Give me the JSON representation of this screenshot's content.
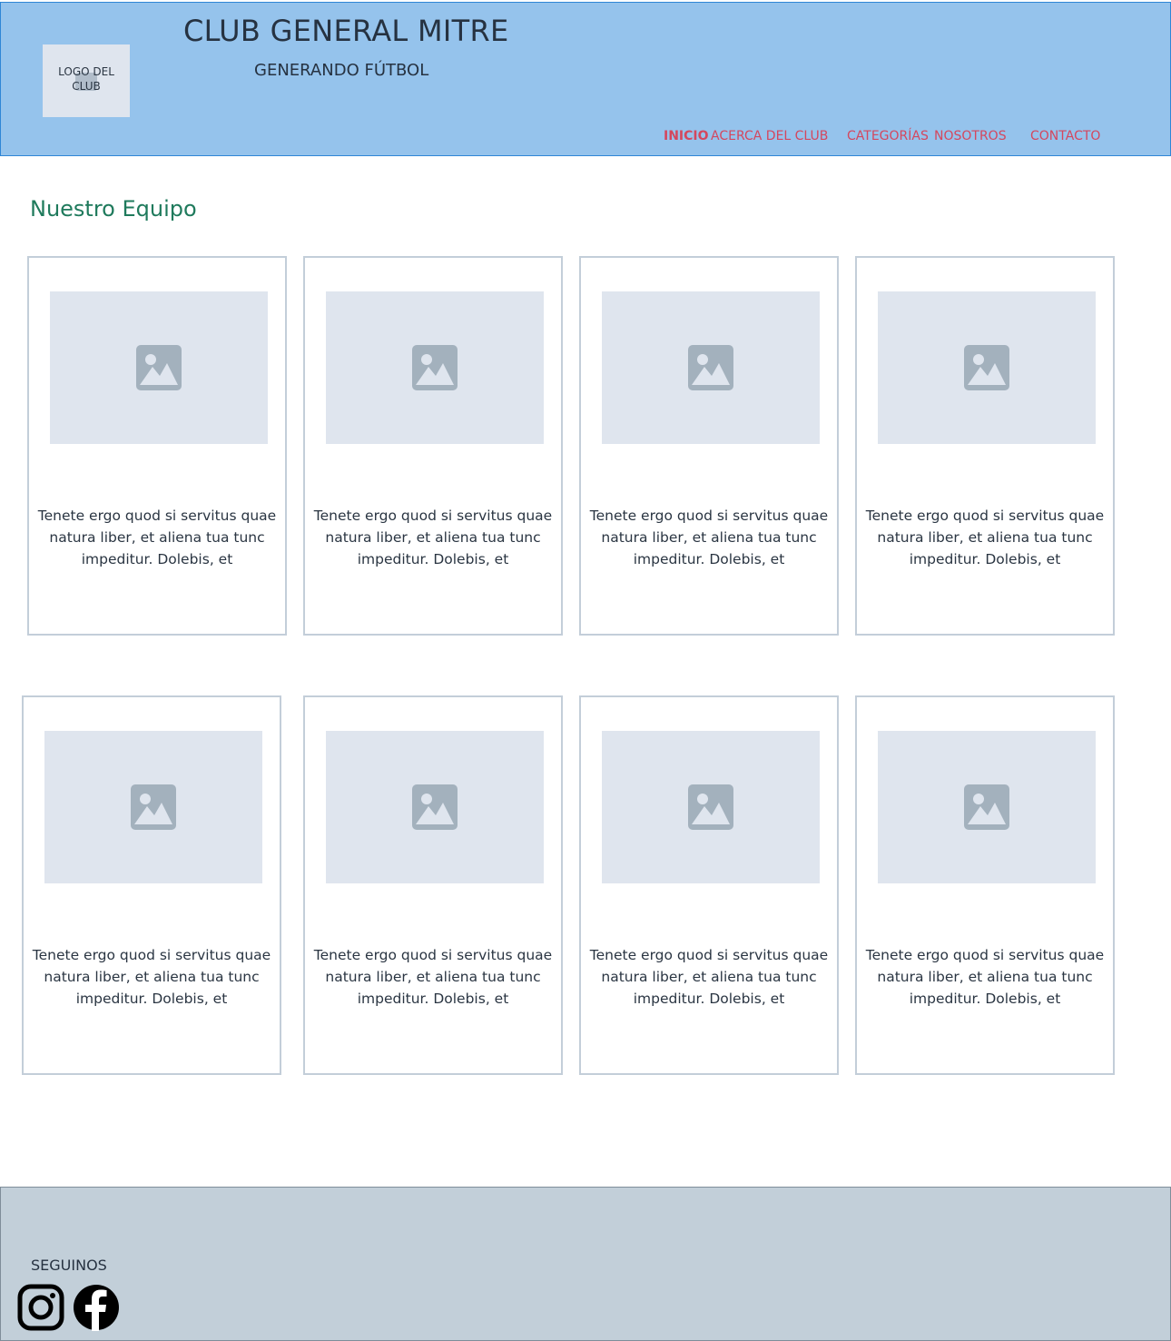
{
  "header": {
    "logo_text": "LOGO DEL CLUB",
    "title": "CLUB GENERAL MITRE",
    "subtitle": "GENERANDO FÚTBOL",
    "nav": [
      {
        "label": "INICIO",
        "active": true
      },
      {
        "label": "ACERCA DEL CLUB",
        "active": false
      },
      {
        "label": "CATEGORÍAS",
        "active": false
      },
      {
        "label": "NOSOTROS",
        "active": false
      },
      {
        "label": "CONTACTO",
        "active": false
      }
    ]
  },
  "main": {
    "section_title": "Nuestro Equipo",
    "cards": [
      {
        "text": "Tenete ergo quod si servitus quae natura liber, et aliena tua tunc impeditur. Dolebis, et"
      },
      {
        "text": "Tenete ergo quod si servitus quae natura liber, et aliena tua tunc impeditur. Dolebis, et"
      },
      {
        "text": "Tenete ergo quod si servitus quae natura liber, et aliena tua tunc impeditur. Dolebis, et"
      },
      {
        "text": "Tenete ergo quod si servitus quae natura liber, et aliena tua tunc impeditur. Dolebis, et"
      },
      {
        "text": "Tenete ergo quod si servitus quae natura liber, et aliena tua tunc impeditur. Dolebis, et"
      },
      {
        "text": "Tenete ergo quod si servitus quae natura liber, et aliena tua tunc impeditur. Dolebis, et"
      },
      {
        "text": "Tenete ergo quod si servitus quae natura liber, et aliena tua tunc impeditur. Dolebis, et"
      },
      {
        "text": "Tenete ergo quod si servitus quae natura liber, et aliena tua tunc impeditur. Dolebis, et"
      }
    ],
    "card_image_icon": "image-placeholder-icon"
  },
  "footer": {
    "label": "SEGUINOS",
    "social": [
      {
        "icon": "instagram-icon"
      },
      {
        "icon": "facebook-icon"
      }
    ]
  },
  "colors": {
    "header_bg": "#95c3ec",
    "header_border": "#2f86d6",
    "nav_text": "#d4475e",
    "section_title": "#1f7a5c",
    "card_border": "#c3ced9",
    "image_placeholder": "#dfe5ee",
    "footer_bg": "#c2cfd9"
  }
}
